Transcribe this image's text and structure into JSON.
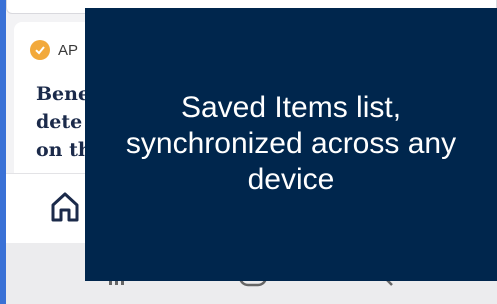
{
  "article": {
    "source_name": "AP",
    "headline_lines": [
      "Bene",
      "dete",
      "on th"
    ]
  },
  "icons": {
    "verified": "verified-badge-icon",
    "home": "home-icon",
    "recents": "recents-icon",
    "home_button": "system-home-icon",
    "back": "back-icon"
  },
  "tooltip": {
    "text": "Saved Items list,\nsynchronized across any\ndevice"
  },
  "colors": {
    "tooltip_bg": "#00264d",
    "verified": "#f2a93b",
    "headline": "#1b2a4a",
    "frame": "#3a71d6"
  }
}
